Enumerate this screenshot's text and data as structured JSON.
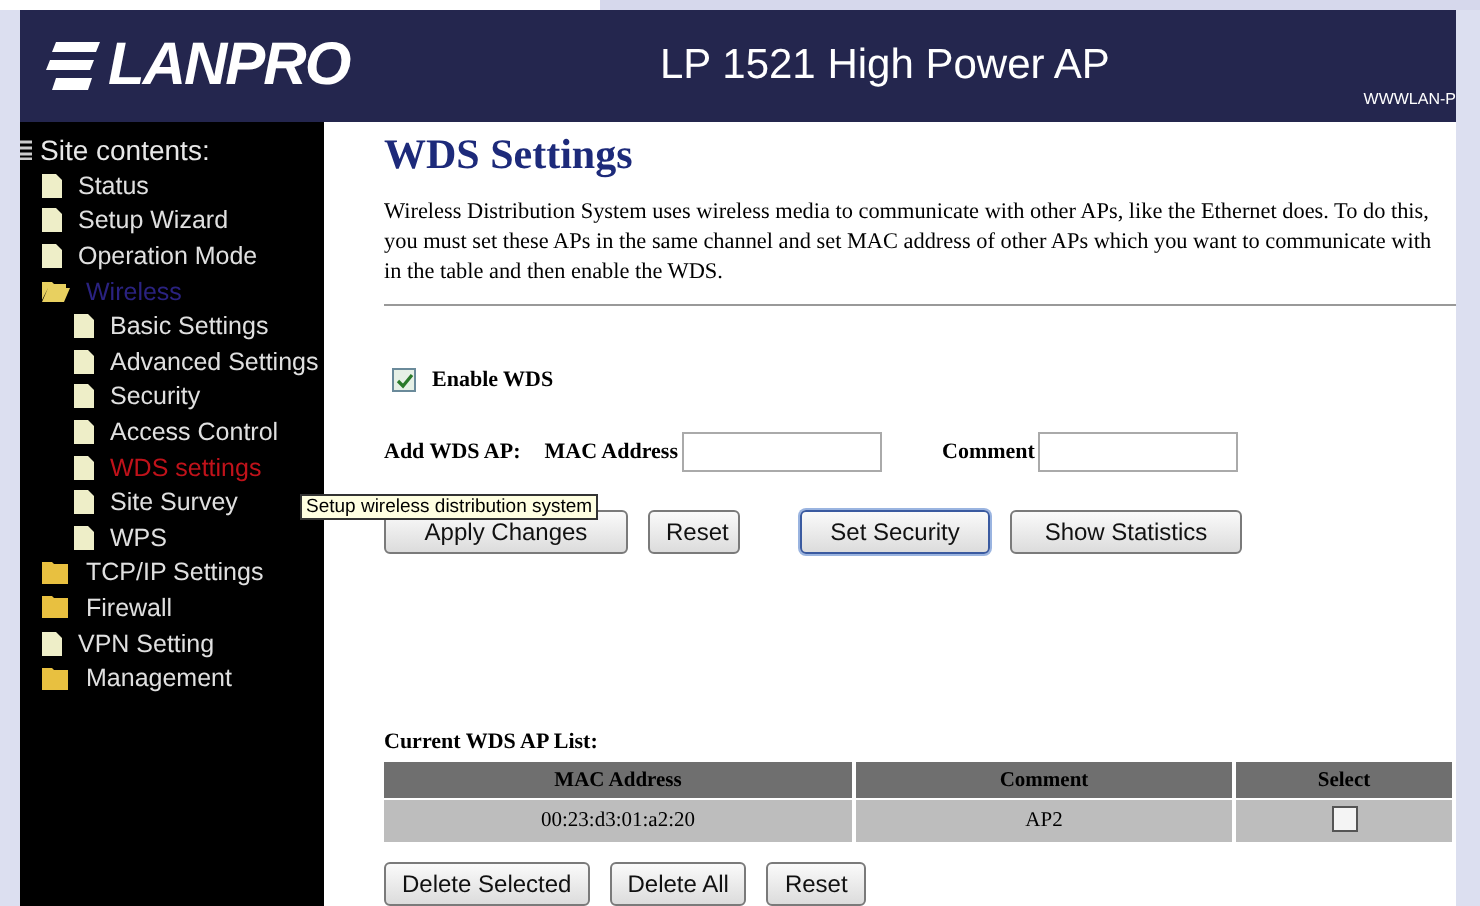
{
  "header": {
    "logo": "LANPRO",
    "title": "LP 1521 High Power AP",
    "url": "WWWLAN-P"
  },
  "sidebar": {
    "heading": "Site contents:",
    "items": [
      {
        "label": "Status",
        "kind": "page",
        "selected": false
      },
      {
        "label": "Setup Wizard",
        "kind": "page",
        "selected": false
      },
      {
        "label": "Operation Mode",
        "kind": "page",
        "selected": false
      },
      {
        "label": "Wireless",
        "kind": "folder",
        "expanded": true,
        "selected": false,
        "children": [
          {
            "label": "Basic Settings",
            "kind": "page",
            "selected": false
          },
          {
            "label": "Advanced Settings",
            "kind": "page",
            "selected": false
          },
          {
            "label": "Security",
            "kind": "page",
            "selected": false
          },
          {
            "label": "Access Control",
            "kind": "page",
            "selected": false
          },
          {
            "label": "WDS settings",
            "kind": "page",
            "selected": true
          },
          {
            "label": "Site Survey",
            "kind": "page",
            "selected": false
          },
          {
            "label": "WPS",
            "kind": "page",
            "selected": false
          }
        ]
      },
      {
        "label": "TCP/IP Settings",
        "kind": "folder",
        "expanded": false,
        "selected": false
      },
      {
        "label": "Firewall",
        "kind": "folder",
        "expanded": false,
        "selected": false
      },
      {
        "label": "VPN Setting",
        "kind": "page",
        "selected": false
      },
      {
        "label": "Management",
        "kind": "folder",
        "expanded": false,
        "selected": false
      }
    ],
    "tooltip": "Setup wireless distribution system"
  },
  "page": {
    "title": "WDS Settings",
    "description": "Wireless Distribution System uses wireless media to communicate with other APs, like the Ethernet does. To do this, you must set these APs in the same channel and set MAC address of other APs which you want to communicate with in the table and then enable the WDS.",
    "enable_wds": {
      "label": "Enable WDS",
      "checked": true
    },
    "add": {
      "label": "Add WDS AP:",
      "mac_label": "MAC Address",
      "comment_label": "Comment"
    },
    "buttons": [
      {
        "label": "Apply Changes",
        "focused": false
      },
      {
        "label": "Reset",
        "focused": false
      },
      {
        "label": "Set Security",
        "focused": true
      },
      {
        "label": "Show Statistics",
        "focused": false
      }
    ],
    "list_title": "Current WDS AP List:",
    "table": {
      "columns": [
        "MAC Address",
        "Comment",
        "Select"
      ],
      "rows": [
        {
          "mac": "00:23:d3:01:a2:20",
          "comment": "AP2",
          "checked": false
        }
      ]
    },
    "bottom_buttons": [
      "Delete Selected",
      "Delete All",
      "Reset"
    ]
  }
}
